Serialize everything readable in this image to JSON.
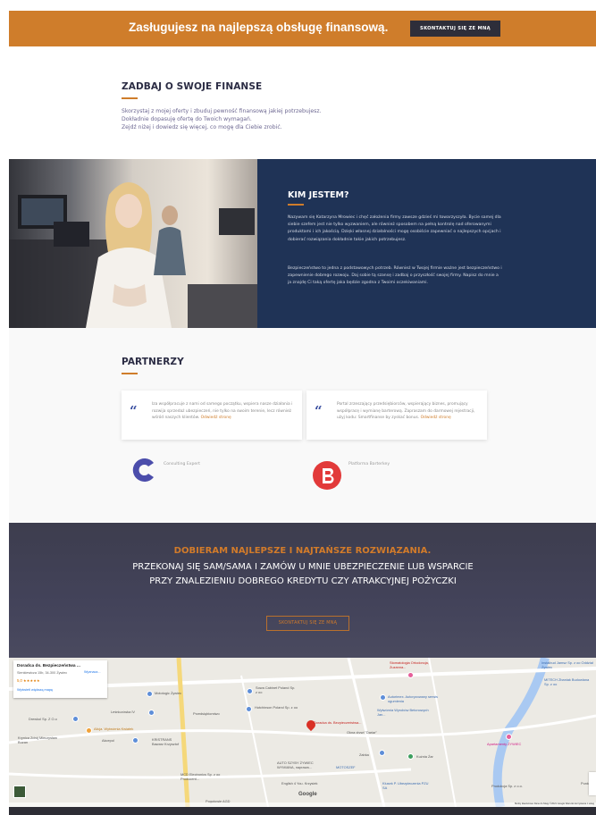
{
  "banner": {
    "title": "Zasługujesz na najlepszą obsługę finansową.",
    "button": "SKONTAKTUJ SIĘ ZE MNĄ"
  },
  "finance": {
    "heading": "ZADBAJ O SWOJE FINANSE",
    "lines": [
      "Skorzystaj z mojej oferty i zbuduj pewność finansową jakiej potrzebujesz.",
      "Dokładnie dopasuję ofertę do Twoich wymagań.",
      "Zejdź niżej i dowiedz się więcej, co mogę dla Ciebie zrobić."
    ]
  },
  "about": {
    "heading": "KIM JESTEM?",
    "p1": "Nazywam się Katarzyna Mrowiec i chęć założenia firmy zawsze gdzieś mi towarzyszyła. Bycie samej dla siebie szefem jest nie tylko wyzwaniem, ale również sposobem na pełną kontrolę nad oferowanymi produktami i ich jakością. Dzięki własnej działalności mogę osobiście zapewniać o najlepszych opcjach i dobierać rozwiązania dokładnie takie jakich potrzebujesz.",
    "p2": "Bezpieczeństwo to jedna z podstawowych potrzeb. Również w Twojej firmie ważne jest bezpieczeństwo i zapewnienie dobrego rozwoju. Daj sobie tą szansę i zadbaj o przyszłość swojej firmy. Napisz do mnie a ja znajdę Ci taką ofertę jaka będzie zgodna z Twoimi oczekiwaniami."
  },
  "partners": {
    "heading": "PARTNERZY",
    "cards": [
      {
        "text": "Iza współpracuje z nami od samego początku, wspiera nasze działania i rozwija sprzedaż ubezpieczeń, nie tylko na swoim terenie, lecz również wśród naszych klientów.",
        "link": "Odwiedź stronę",
        "name": "Consulting Expert"
      },
      {
        "text": "Portal zrzeszający przedsiębiorców, wspierający biznes, promujący współpracę i wymianę barterową. Zapraszam do darmowej rejestracji, użyj kodu: Smartfinanse by zyskać bonus.",
        "link": "Odwiedź stronę",
        "name": "Platforma Barterkey"
      }
    ]
  },
  "cta": {
    "line1": "DOBIERAM NAJLEPSZE I NAJTAŃSZE ROZWIĄZANIA.",
    "line2": "PRZEKONAJ SIĘ SAM/SAMA I ZAMÓW U MNIE UBEZPIECZENIE LUB WSPARCIE PRZY ZNALEZIENIU DOBREGO KREDYTU CZY ATRAKCYJNEJ POŻYCZKI",
    "button": "SKONTAKTUJ SIĘ ZE MNĄ"
  },
  "map": {
    "place_name": "Doradca ds. Bezpieczeństwa ...",
    "address": "Sienkiewicza 15b, 34-300 Żywiec",
    "rating": "5,0 ★★★★★",
    "directions": "Wyznacz...",
    "larger_map": "Wyświetl większą mapę",
    "pin_label": "Doradca ds. Bezpieczeństwa...",
    "google": "Google",
    "terms": "Skróty klawiszowe   Dane do Mapy ©2021 Google   Warunki korzystania z usług",
    "labels": [
      "Stomatologia Ortodoncja, Zuzanna...",
      "Instalbud Jamsz Sp. z oo Oddział Żywiec",
      "MITECH Zbaniak Budowlana Sp. z oo",
      "Autorimex. Autoryzowany serwis ogumienia",
      "Wytwórnia Wyrobów Betonowych Jan...",
      "Sowa Cabinet Poland Sp. z oo",
      "Hutchinson Poland Sp. z oo",
      "Mototogic Żywiec",
      "Leśniczówka IV",
      "Przedsiębiorstwo",
      "Drewkol Sp. Z O.o",
      "Alicja. Wytwórnia Kwiatek",
      "Krynica Zdrój Mieczysław Buzan",
      "Akcepol",
      "KRISTRANS Bawarz Krzysztof",
      "MCD Electronics Sp. z oo Producent...",
      "AUTO SZYBY ŻYWIEC WYMIANA, naprawa...",
      "MOTOSZEF",
      "Zabka",
      "Kuźnia Żar",
      "Apartamenty ŻYWIEC",
      "Pogotowie AGD",
      "English 4 You. Krzysiek",
      "Klusek P. Ubezpieczenia PZU SA",
      "Produkcja Sp. z o.o.",
      "Okna drzwi \"Dariar\"",
      "Punkt"
    ]
  }
}
